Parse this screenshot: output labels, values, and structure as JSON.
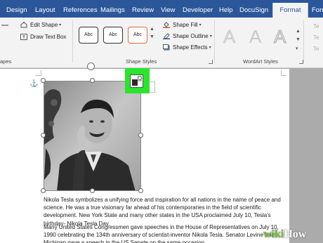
{
  "tabs": [
    "Design",
    "Layout",
    "References",
    "Mailings",
    "Review",
    "View",
    "Developer",
    "Help",
    "DocuSign",
    "Format",
    "Form"
  ],
  "active_tab": "Format",
  "ribbon": {
    "insert_shapes": {
      "edit_shape": "Edit Shape",
      "draw_text_box": "Draw Text Box",
      "group_label": "apes"
    },
    "shape_styles": {
      "preset_labels": [
        "Abc",
        "Abc",
        "Abc"
      ],
      "shape_fill": "Shape Fill",
      "shape_outline": "Shape Outline",
      "shape_effects": "Shape Effects",
      "group_label": "Shape Styles"
    },
    "wordart": {
      "letters": [
        "A",
        "A",
        "A"
      ],
      "side_text": [
        "Te",
        "Te",
        "Te"
      ],
      "group_label": "WordArt Styles"
    }
  },
  "document": {
    "paragraph1": "Nikola Tesla symbolizes a unifying force and inspiration for all nations in the name of peace and science. He was a true visionary far ahead of his contemporaries in the field of scientific development. New York State and many other states in the USA proclaimed July 10, Tesla's birthday- Nikola Tesla Day.",
    "paragraph2": "Many United States Congressmen gave speeches in the House of Representatives on July 10, 1990 celebrating the 134th anniversary of scientist-inventor Nikola Tesla. Senator Levine from Michigan gave a speech in the US Senate on the same occasion."
  },
  "watermark": {
    "prefix": "wiki",
    "suffix": "How"
  },
  "colors": {
    "tab_bar": "#2b579a",
    "highlight": "#29e52d",
    "shape_fill_underline": "#d8542c",
    "shape_outline_underline": "#2b579a"
  }
}
